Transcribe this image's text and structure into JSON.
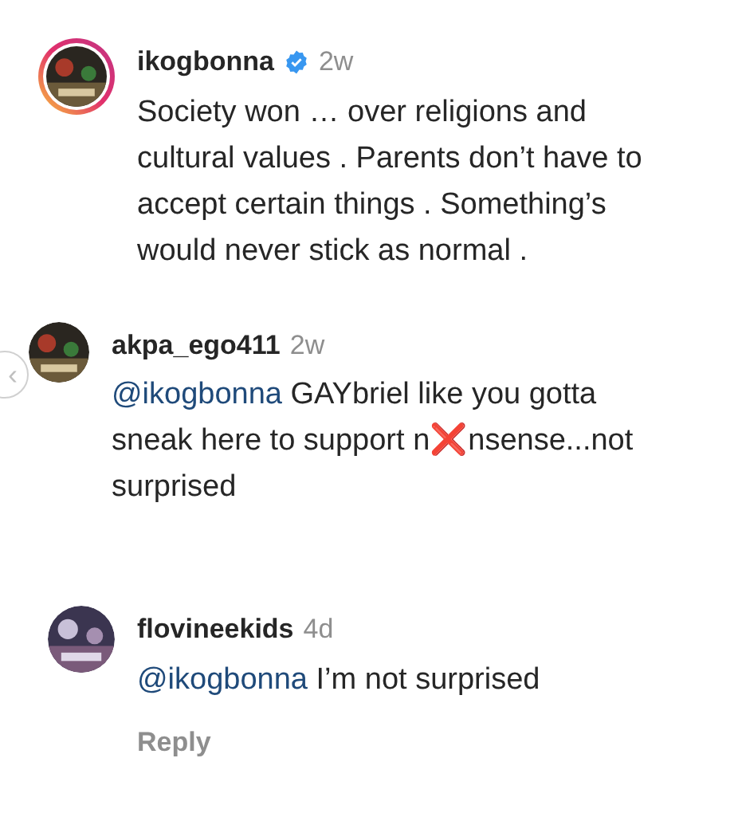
{
  "comments": [
    {
      "username": "ikogbonna",
      "verified": true,
      "has_story": true,
      "time": "2w",
      "text": "Society won … over religions and cultural values . Parents don’t have to accept certain things . Something’s would never stick as normal ."
    },
    {
      "username": "akpa_ego411",
      "verified": false,
      "has_story": false,
      "time": "2w",
      "mention": "@ikogbonna",
      "text": "GAYbriel like you gotta sneak here to support n❌nsense...not surprised",
      "children": [
        {
          "username": "flovineekids",
          "verified": false,
          "has_story": false,
          "time": "4d",
          "mention": "@ikogbonna",
          "text": "I’m not surprised",
          "reply_label": "Reply"
        }
      ]
    }
  ],
  "prev_button": "‹"
}
